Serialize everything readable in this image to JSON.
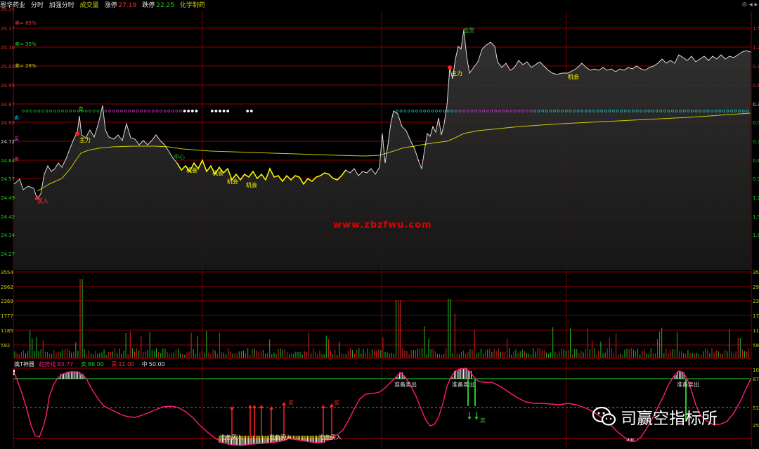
{
  "header": {
    "stock_name": "恩华药业",
    "tabs": [
      "分时",
      "加强分时"
    ],
    "volume_label": "成交量",
    "limit_up_label": "涨停",
    "limit_up_value": "27.19",
    "limit_down_label": "跌停",
    "limit_down_value": "22.25",
    "sector": "化学制药",
    "controls": [
      "⊙",
      "◂",
      "▸"
    ]
  },
  "left_axis": {
    "price_ticks": [
      "25.25",
      "25.17",
      "25.10",
      "25.03",
      "24.95",
      "24.87",
      "24.80",
      "24.72",
      "24.64",
      "24.57",
      "24.49",
      "24.42",
      "24.34",
      "24.27"
    ],
    "volume_ticks": [
      "3554",
      "2962",
      "2369",
      "1777",
      "1185",
      "592"
    ],
    "side_labels": [
      "卖= 65%",
      "卖= 35%",
      "差= 28%",
      "卖",
      "买",
      "卖"
    ],
    "tick_colors": {
      "up": "#e03030",
      "mid": "#dddddd",
      "down": "#22cc22"
    }
  },
  "right_axis": {
    "percent_ticks": [
      "1.5",
      "1.2",
      "0.9",
      "0.6",
      "0.3",
      "0.0",
      "0.3",
      "0.6",
      "0.9",
      "1.2",
      "1.5",
      "1.8"
    ],
    "volume_ticks": [
      "35",
      "29",
      "23",
      "17",
      "11",
      "59"
    ],
    "osc_ticks": [
      "10",
      "87",
      "51",
      "25"
    ]
  },
  "annotations": {
    "buy": "买入",
    "main_force": "主力",
    "center": "中心",
    "opportunity": "机会",
    "ship_out": "出货",
    "sell_top": "卖",
    "prepare_sell": "准备卖出",
    "prepare_buy": "准备买入",
    "buy_small": "买",
    "sell_small": "卖"
  },
  "osc_header": {
    "name": "擒T神器",
    "trend_label": "趋势线",
    "trend_value": "83.77",
    "sell_label": "卖",
    "sell_value": "88.00",
    "buy_label": "买",
    "buy_value": "11.00",
    "mid_label": "中",
    "mid_value": "50.00"
  },
  "watermark": "www.zbzfwu.com",
  "wechat": {
    "icon": "wechat-icon",
    "text": "司赢空指标所"
  },
  "colors": {
    "grid": "#8b0000",
    "price_line": "#dcdcdc",
    "avg_line": "#cccc00",
    "highlight": "#ffff00",
    "osc_line": "#ff1a7a",
    "green": "#22cc22",
    "red": "#ff2020"
  }
}
